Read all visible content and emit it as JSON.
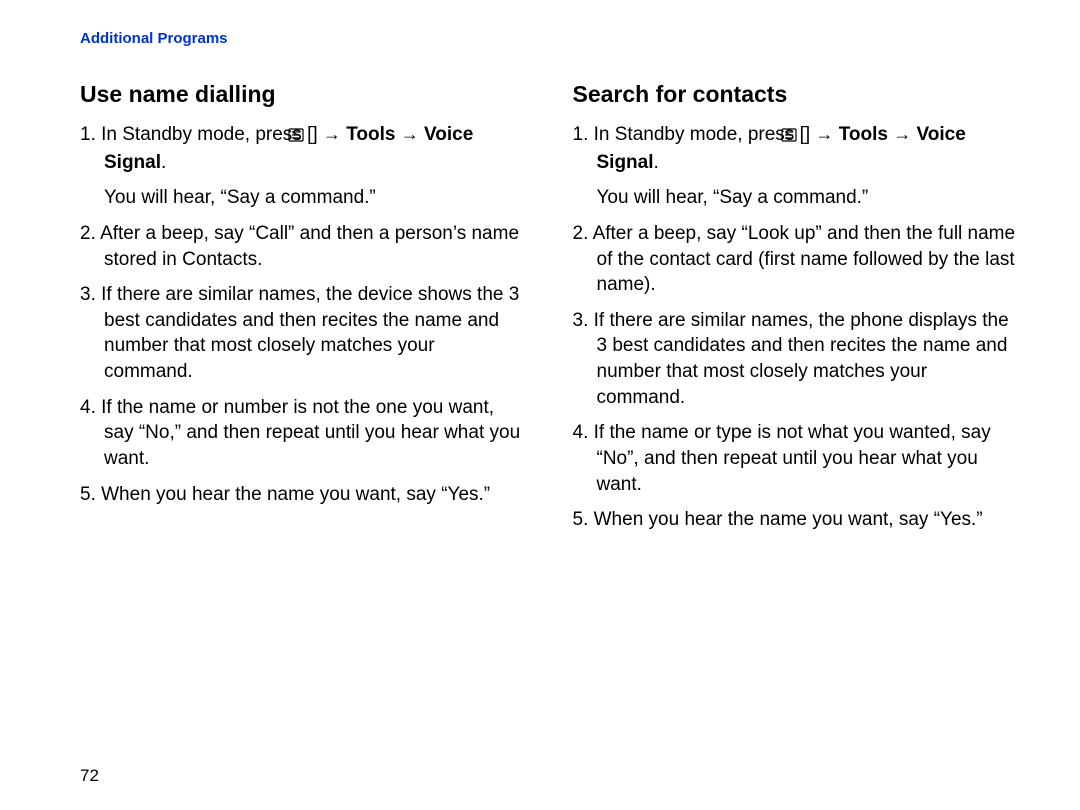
{
  "header": "Additional Programs",
  "page_number": "72",
  "arrow": "→",
  "left": {
    "title": "Use name dialling",
    "step1_a": "1. In Standby mode, press [",
    "step1_b": "] ",
    "step1_tools": "Tools",
    "step1_arrow2": " ",
    "step1_voice": "Voice Signal",
    "step1_end": ".",
    "sub1": "You will hear, “Say a command.”",
    "step2": "2. After a beep, say “Call” and then a person’s name stored in Contacts.",
    "step3": "3. If there are similar names, the device shows the 3 best candidates and then recites the name and number that most closely matches your command.",
    "step4": "4. If the name or number is not the one you want, say “No,” and then repeat until you hear what you want.",
    "step5": "5. When you hear the name you want, say “Yes.”"
  },
  "right": {
    "title": "Search for contacts",
    "step1_a": "1. In Standby mode, press [",
    "step1_b": "] ",
    "step1_tools": "Tools",
    "step1_arrow2": " ",
    "step1_voice": "Voice Signal",
    "step1_end": ".",
    "sub1": "You will hear, “Say a command.”",
    "step2": "2. After a beep, say “Look up” and then the full name of the contact card (first name followed by the last name).",
    "step3": "3. If there are similar names, the phone displays the 3 best candidates and then recites the name and number that most closely matches your command.",
    "step4": "4. If the name or type is not what you wanted, say “No”, and then repeat until you hear what you want.",
    "step5": "5. When you hear the name you want, say “Yes.”"
  }
}
